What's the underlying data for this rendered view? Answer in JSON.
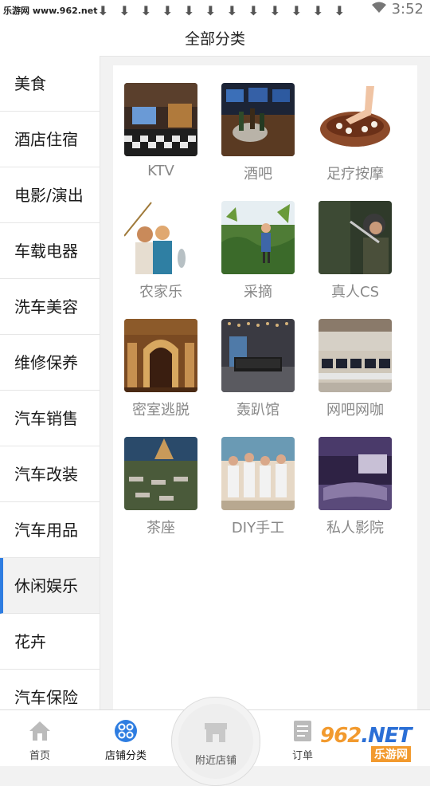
{
  "status_bar": {
    "watermark": "乐游网 www.962.net",
    "time": "3:52",
    "download_icon_count": 13
  },
  "header": {
    "title": "全部分类"
  },
  "sidebar": {
    "items": [
      {
        "label": "美食",
        "active": false
      },
      {
        "label": "酒店住宿",
        "active": false
      },
      {
        "label": "电影/演出",
        "active": false
      },
      {
        "label": "车载电器",
        "active": false
      },
      {
        "label": "洗车美容",
        "active": false
      },
      {
        "label": "维修保养",
        "active": false
      },
      {
        "label": "汽车销售",
        "active": false
      },
      {
        "label": "汽车改装",
        "active": false
      },
      {
        "label": "汽车用品",
        "active": false
      },
      {
        "label": "休闲娱乐",
        "active": true
      },
      {
        "label": "花卉",
        "active": false
      },
      {
        "label": "汽车保险",
        "active": false
      }
    ],
    "accent_color": "#2e7de1"
  },
  "categories": [
    {
      "label": "KTV",
      "image": "ktv-room-image"
    },
    {
      "label": "酒吧",
      "image": "bar-image"
    },
    {
      "label": "足疗按摩",
      "image": "foot-massage-image"
    },
    {
      "label": "农家乐",
      "image": "farm-stay-image"
    },
    {
      "label": "采摘",
      "image": "picking-image"
    },
    {
      "label": "真人CS",
      "image": "live-cs-image"
    },
    {
      "label": "密室逃脱",
      "image": "escape-room-image"
    },
    {
      "label": "轰趴馆",
      "image": "party-house-image"
    },
    {
      "label": "网吧网咖",
      "image": "internet-cafe-image"
    },
    {
      "label": "茶座",
      "image": "tea-house-image"
    },
    {
      "label": "DIY手工",
      "image": "diy-craft-image"
    },
    {
      "label": "私人影院",
      "image": "private-cinema-image"
    }
  ],
  "tabbar": {
    "home": {
      "label": "首页",
      "icon": "home-icon"
    },
    "shop_category": {
      "label": "店铺分类",
      "icon": "category-grid-icon",
      "active": true
    },
    "nearby": {
      "label": "附近店铺",
      "icon": "store-icon"
    },
    "orders": {
      "label": "订单",
      "icon": "order-list-icon"
    }
  },
  "watermark": {
    "main_prefix": "962",
    "main_suffix": ".NET",
    "sub": "乐游网"
  }
}
